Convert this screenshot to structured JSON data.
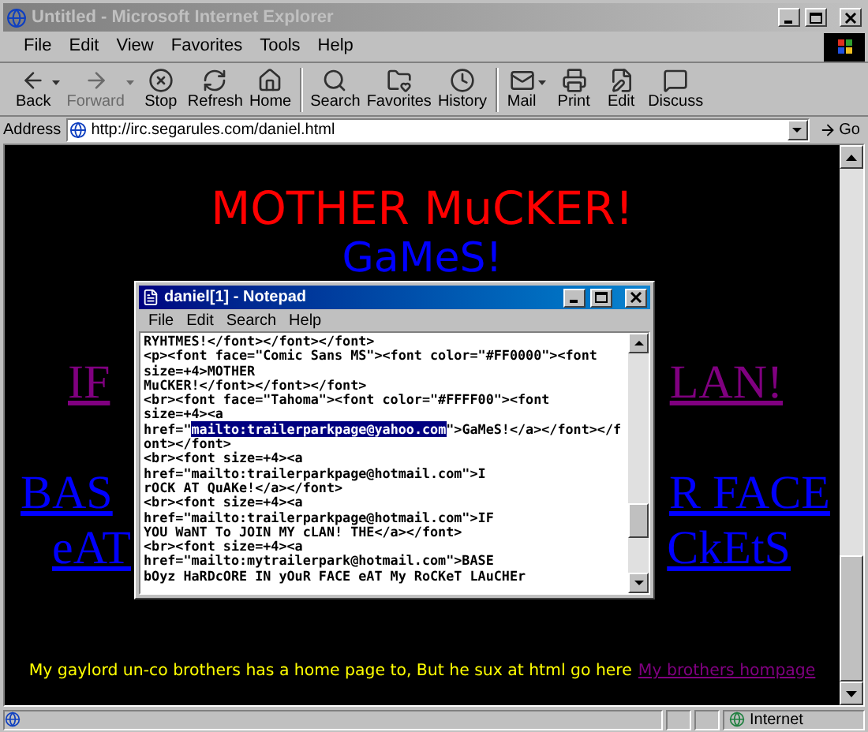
{
  "window": {
    "title": "Untitled - Microsoft Internet Explorer"
  },
  "menu": [
    "File",
    "Edit",
    "View",
    "Favorites",
    "Tools",
    "Help"
  ],
  "toolbar": [
    {
      "label": "Back",
      "kind": "back",
      "disabled": false,
      "dropdown": true
    },
    {
      "label": "Forward",
      "kind": "forward",
      "disabled": true,
      "dropdown": true
    },
    {
      "label": "Stop",
      "kind": "stop",
      "disabled": false,
      "dropdown": false
    },
    {
      "label": "Refresh",
      "kind": "refresh",
      "disabled": false,
      "dropdown": false
    },
    {
      "label": "Home",
      "kind": "home",
      "disabled": false,
      "dropdown": false
    },
    {
      "label": "Search",
      "kind": "search",
      "disabled": false,
      "dropdown": false
    },
    {
      "label": "Favorites",
      "kind": "favorites",
      "disabled": false,
      "dropdown": false
    },
    {
      "label": "History",
      "kind": "history",
      "disabled": false,
      "dropdown": false
    },
    {
      "label": "Mail",
      "kind": "mail",
      "disabled": false,
      "dropdown": true
    },
    {
      "label": "Print",
      "kind": "print",
      "disabled": false,
      "dropdown": false
    },
    {
      "label": "Edit",
      "kind": "edit",
      "disabled": false,
      "dropdown": false
    },
    {
      "label": "Discuss",
      "kind": "discuss",
      "disabled": false,
      "dropdown": false
    }
  ],
  "address": {
    "label": "Address",
    "value": "http://irc.segarules.com/daniel.html",
    "go": "Go"
  },
  "page": {
    "lines": [
      {
        "kind": "heading",
        "text": "MOTHER MuCKER!",
        "color": "#ff0000"
      },
      {
        "kind": "centered",
        "text": "GaMeS!",
        "color": "#0000ff"
      },
      {
        "kind": "split",
        "left": "IF",
        "right": "LAN!",
        "color": "#800080"
      },
      {
        "kind": "split",
        "left": "BAS",
        "right": "R FACE",
        "color": "#0000ff"
      },
      {
        "kind": "split",
        "left": "eAT",
        "right": "CkEtS",
        "color": "#0000ff"
      }
    ],
    "footer": {
      "text": "My gaylord un-co brothers has a home page to, But he sux at html go here",
      "link": "My brothers hompage"
    }
  },
  "notepad": {
    "title": "daniel[1] - Notepad",
    "menu": [
      "File",
      "Edit",
      "Search",
      "Help"
    ],
    "lines": [
      {
        "segments": [
          {
            "text": "RYHTMES!</font></font></font>",
            "selected": false
          }
        ]
      },
      {
        "segments": [
          {
            "text": "<p><font face=\"Comic Sans MS\"><font color=\"#FF0000\"><font",
            "selected": false
          }
        ]
      },
      {
        "segments": [
          {
            "text": "size=+4>MOTHER",
            "selected": false
          }
        ]
      },
      {
        "segments": [
          {
            "text": "MuCKER!</font></font></font>",
            "selected": false
          }
        ]
      },
      {
        "segments": [
          {
            "text": "<br><font face=\"Tahoma\"><font color=\"#FFFF00\"><font",
            "selected": false
          }
        ]
      },
      {
        "segments": [
          {
            "text": "size=+4><a",
            "selected": false
          }
        ]
      },
      {
        "segments": [
          {
            "text": "href=\"",
            "selected": false
          },
          {
            "text": "mailto:trailerparkpage@yahoo.com",
            "selected": true
          },
          {
            "text": "\">GaMeS!</a></font></f",
            "selected": false
          }
        ]
      },
      {
        "segments": [
          {
            "text": "ont></font>",
            "selected": false
          }
        ]
      },
      {
        "segments": [
          {
            "text": "<br><font size=+4><a",
            "selected": false
          }
        ]
      },
      {
        "segments": [
          {
            "text": "href=\"mailto:trailerparkpage@hotmail.com\">I",
            "selected": false
          }
        ]
      },
      {
        "segments": [
          {
            "text": "rOCK AT QuAKe!</a></font>",
            "selected": false
          }
        ]
      },
      {
        "segments": [
          {
            "text": "<br><font size=+4><a",
            "selected": false
          }
        ]
      },
      {
        "segments": [
          {
            "text": "href=\"mailto:trailerparkpage@hotmail.com\">IF",
            "selected": false
          }
        ]
      },
      {
        "segments": [
          {
            "text": "YOU WaNT To JOIN MY cLAN! THE</a></font>",
            "selected": false
          }
        ]
      },
      {
        "segments": [
          {
            "text": "<br><font size=+4><a",
            "selected": false
          }
        ]
      },
      {
        "segments": [
          {
            "text": "href=\"mailto:mytrailerpark@hotmail.com\">BASE",
            "selected": false
          }
        ]
      },
      {
        "segments": [
          {
            "text": "bOyz HaRDcORE IN yOuR FACE eAT My RoCKeT LAuCHEr",
            "selected": false
          }
        ]
      }
    ]
  },
  "status_bar": {
    "zone": "Internet"
  }
}
